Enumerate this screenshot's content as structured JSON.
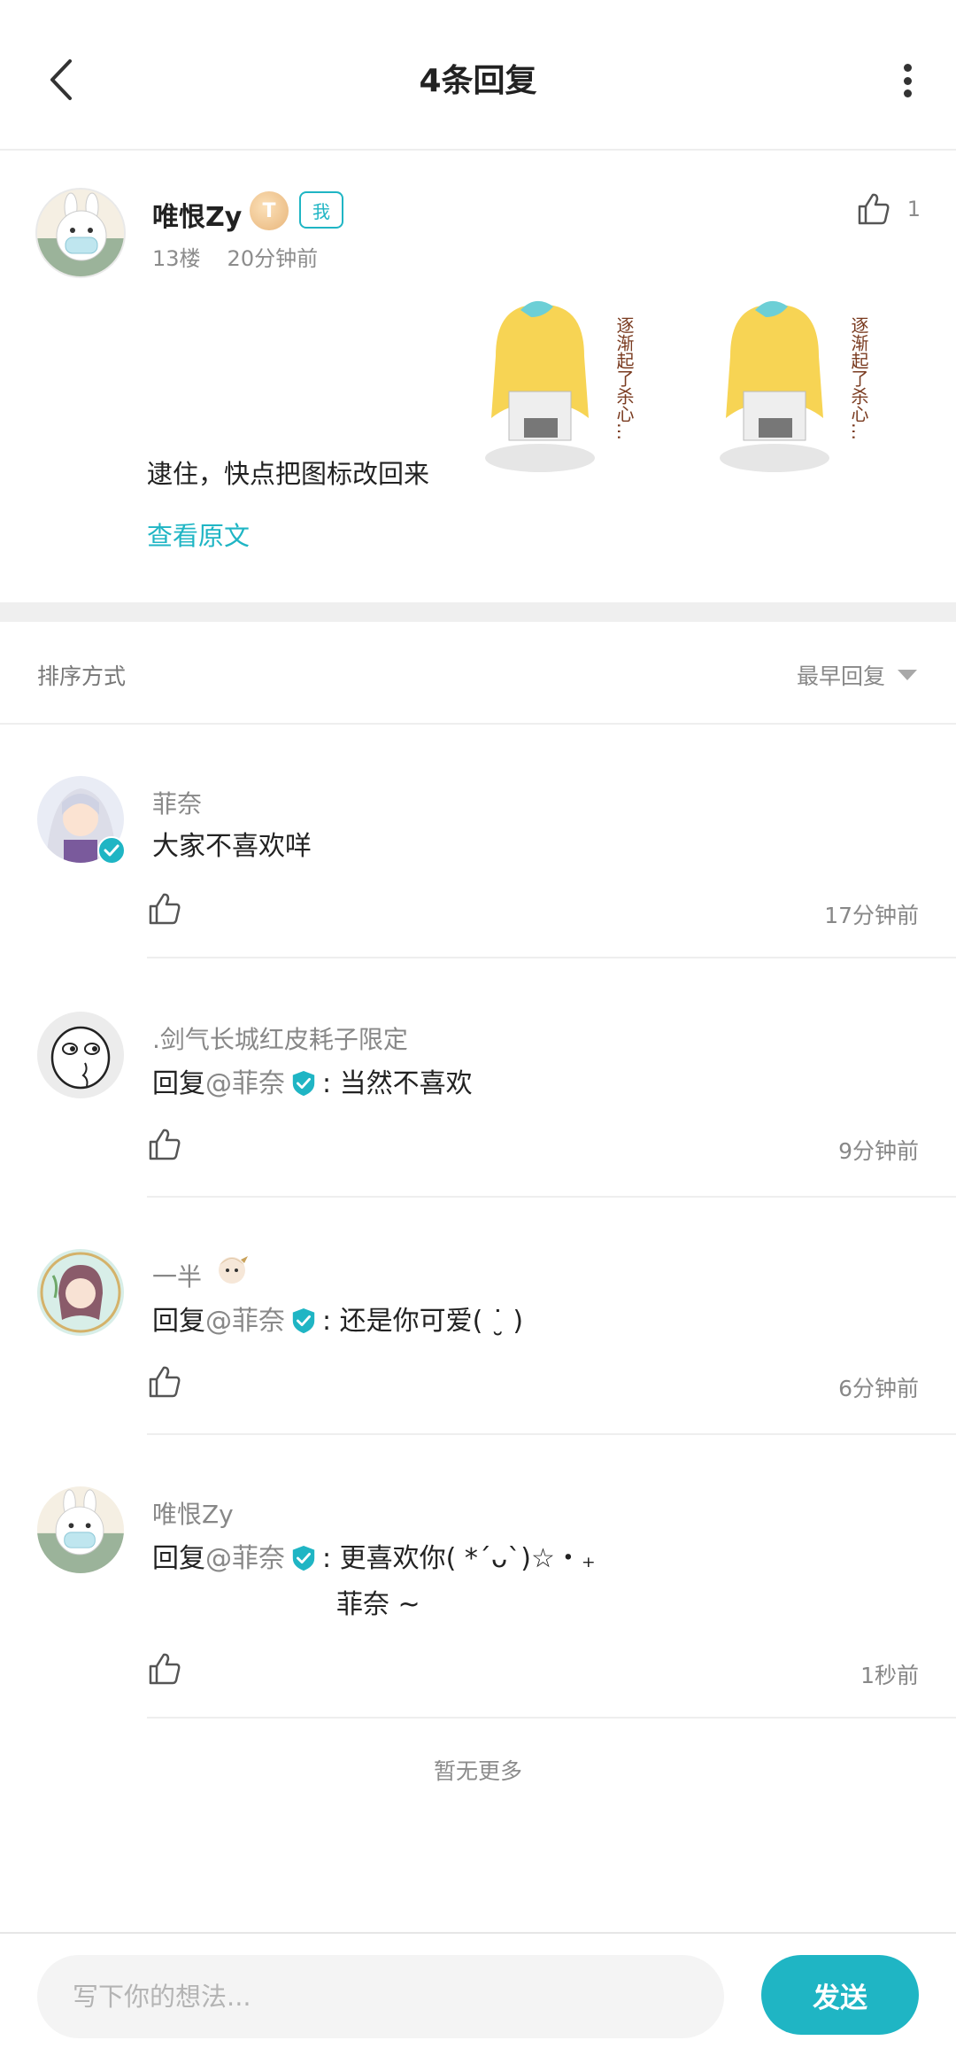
{
  "header": {
    "title": "4条回复"
  },
  "post": {
    "author": "唯恨Zy",
    "level_badge": "T",
    "me_tag": "我",
    "floor": "13楼",
    "time": "20分钟前",
    "like_count": "1",
    "text": "逮住，快点把图标改回来",
    "view_original": "查看原文",
    "sticker_text": "逐渐起了杀心…"
  },
  "sort": {
    "label": "排序方式",
    "selected": "最早回复"
  },
  "replies": [
    {
      "name": "菲奈",
      "content": "大家不喜欢咩",
      "time": "17分钟前"
    },
    {
      "name": ".剑气长城红皮耗子限定",
      "prefix": "回复",
      "mention": "@菲奈",
      "content": ": 当然不喜欢",
      "time": "9分钟前"
    },
    {
      "name": "一半",
      "prefix": "回复",
      "mention": "@菲奈",
      "content": ": 还是你可爱( ˙̮ )",
      "time": "6分钟前"
    },
    {
      "name": "唯恨Zy",
      "prefix": "回复",
      "mention": "@菲奈",
      "content": ": 更喜欢你( *´ᴗ`)☆・₊",
      "content_line2": "菲奈 ~",
      "time": "1秒前"
    }
  ],
  "footer": {
    "no_more": "暂无更多"
  },
  "bottom": {
    "placeholder": "写下你的想法...",
    "send_label": "发送"
  },
  "colors": {
    "accent": "#1fb5c4",
    "muted_text": "#888888",
    "separator": "#efefef"
  }
}
